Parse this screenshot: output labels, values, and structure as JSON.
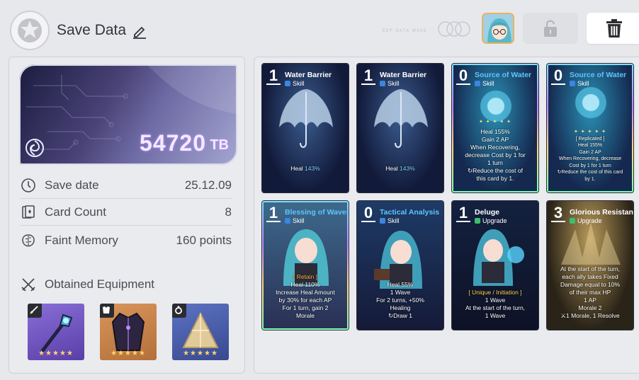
{
  "header": {
    "title": "Save Data",
    "faint_text": "ᴇᴇᴘ ᴅᴀᴛᴀ ᴍᴀᴄᴇ",
    "colors": {
      "accent": "#e9b25f",
      "background": "#e7e8ec"
    }
  },
  "summary": {
    "value": "54720",
    "unit": "TB",
    "stats": [
      {
        "label": "Save date",
        "value": "25.12.09",
        "icon": "clock-icon"
      },
      {
        "label": "Card Count",
        "value": "8",
        "icon": "cards-icon"
      },
      {
        "label": "Faint Memory",
        "value": "160 points",
        "icon": "brain-icon"
      }
    ],
    "equipment_title": "Obtained Equipment",
    "equipment": [
      {
        "icon": "sword-icon",
        "item": "staff-icon",
        "stars": "★★★★★",
        "color": "#7a5cc9"
      },
      {
        "icon": "armor-icon",
        "item": "coat-icon",
        "stars": "★★★★★",
        "color": "#c9874a"
      },
      {
        "icon": "ring-icon",
        "item": "prism-icon",
        "stars": "★★★★★",
        "color": "#4a5dab"
      }
    ]
  },
  "cards": [
    {
      "cost": "1",
      "name": "Water Barrier",
      "type": "Skill",
      "name_color": "white",
      "desc": [
        [
          "Heal ",
          ""
        ],
        [
          "143%",
          "b"
        ]
      ],
      "art": "umbrella"
    },
    {
      "cost": "1",
      "name": "Water Barrier",
      "type": "Skill",
      "name_color": "white",
      "desc": [
        [
          "Heal ",
          ""
        ],
        [
          "143%",
          "b"
        ]
      ],
      "art": "umbrella"
    },
    {
      "cost": "0",
      "name": "Source of Water",
      "type": "Skill",
      "name_color": "blue",
      "lines": [
        "Heal 155%",
        "Gain 2 AP",
        "When Recovering,",
        "decrease Cost by 1 for",
        "1 turn",
        "↻Reduce the cost of",
        "this card by 1."
      ],
      "art": "orb"
    },
    {
      "cost": "0",
      "name": "Source of Water",
      "type": "Skill",
      "name_color": "blue",
      "lines": [
        "[ Replicated ]",
        "Heal 155%",
        "Gain 2 AP",
        "When Recovering, decrease",
        "Cost by 1 for 1 turn",
        "↻Reduce the cost of this card",
        "by 1."
      ],
      "art": "orb",
      "small": true
    },
    {
      "cost": "1",
      "name": "Blessing of Waves",
      "type": "Skill",
      "name_color": "blue",
      "lines": [
        "[ Retain ]",
        "Heal 110%",
        "Increase Heal Amount",
        "by 30% for each AP",
        "For 1 turn, gain 2",
        "Morale"
      ],
      "art": "girl"
    },
    {
      "cost": "0",
      "name": "Tactical Analysis",
      "type": "Skill",
      "name_color": "blue",
      "lines": [
        "Heal 55%",
        "1 Wave",
        "For 2 turns, +50%",
        "Healing",
        "↻Draw 1"
      ],
      "art": "girl"
    },
    {
      "cost": "1",
      "name": "Deluge",
      "type": "Upgrade",
      "name_color": "white",
      "lines": [
        "[ Unique / Initiation ]",
        "1 Wave",
        "At the start of the turn,",
        "1 Wave"
      ],
      "art": "girl2"
    },
    {
      "cost": "3",
      "name": "Glorious Resistance",
      "type": "Upgrade",
      "name_color": "white",
      "lines": [
        "At the start of the turn,",
        "each ally takes Fixed",
        "Damage equal to 10%",
        "of their max HP",
        "1 AP",
        "Morale 2",
        "⚔1 Morale, 1 Resolve"
      ],
      "art": "spikes"
    }
  ]
}
